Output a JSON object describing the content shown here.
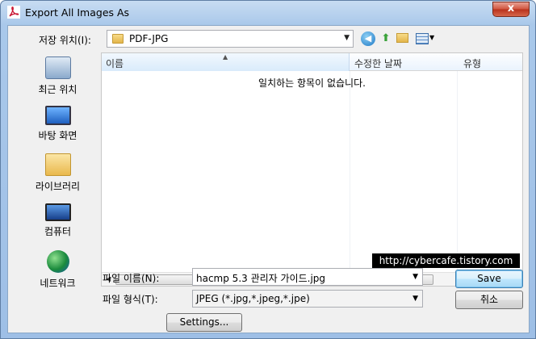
{
  "window": {
    "title": "Export All Images As",
    "close_label": "x"
  },
  "lookin": {
    "label": "저장 위치(I):",
    "value": "PDF-JPG"
  },
  "places": [
    {
      "label": "최근 위치",
      "icon": "recent-places-icon"
    },
    {
      "label": "바탕 화면",
      "icon": "desktop-icon"
    },
    {
      "label": "라이브러리",
      "icon": "library-icon"
    },
    {
      "label": "컴퓨터",
      "icon": "computer-icon"
    },
    {
      "label": "네트워크",
      "icon": "network-icon"
    }
  ],
  "filelist": {
    "columns": [
      "이름",
      "수정한 날짜",
      "유형"
    ],
    "empty_message": "일치하는 항목이 없습니다.",
    "scroll_grip": "III"
  },
  "watermark": "http://cybercafe.tistory.com",
  "filename": {
    "label": "파일 이름(N):",
    "value": "hacmp 5.3 관리자 가이드.jpg"
  },
  "filetype": {
    "label": "파일 형식(T):",
    "value": "JPEG (*.jpg,*.jpeg,*.jpe)"
  },
  "buttons": {
    "save": "Save",
    "cancel": "취소",
    "settings": "Settings..."
  }
}
